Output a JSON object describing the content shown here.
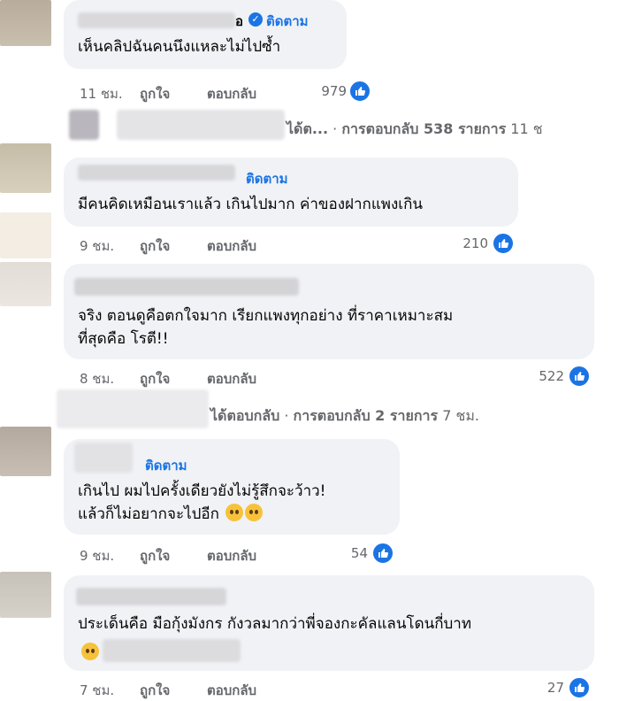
{
  "comments": [
    {
      "text": "เห็นคลิปฉันคนนึงแหละไม่ไปซ้ำ",
      "follow": "ติดตาม",
      "verified": true,
      "time": "11 ชม.",
      "like": "ถูกใจ",
      "reply": "ตอบกลับ",
      "reactions": "979"
    },
    {
      "text": "มีคนคิดเหมือนเราแล้ว เกินไปมาก ค่าของฝากแพงเกิน",
      "follow": "ติดตาม",
      "time": "9 ชม.",
      "like": "ถูกใจ",
      "reply": "ตอบกลับ",
      "reactions": "210"
    },
    {
      "text_line1": "จริง ตอนดูคือตกใจมาก เรียกแพงทุกอย่าง ที่ราคาเหมาะสม",
      "text_line2": "ที่สุดคือ โรตี!!",
      "time": "8 ชม.",
      "like": "ถูกใจ",
      "reply": "ตอบกลับ",
      "reactions": "522"
    },
    {
      "text_line1": "เกินไป ผมไปครั้งเดียวยังไม่รู้สึกจะว้าว!",
      "text_line2": "แล้วก็ไม่อยากจะไปอีก",
      "follow": "ติดตาม",
      "time": "9 ชม.",
      "like": "ถูกใจ",
      "reply": "ตอบกลับ",
      "reactions": "54"
    },
    {
      "text": "ประเด็นคือ มือกุ้งมังกร กังวลมากว่าพี่จองกะคัลแลนโดนกี่บาท",
      "time": "7 ชม.",
      "like": "ถูกใจ",
      "reply": "ตอบกลับ",
      "reactions": "27"
    }
  ],
  "replies_summary_1": {
    "prefix": "ได้ต...",
    "sep": "·",
    "count": "การตอบกลับ 538 รายการ",
    "time": "11 ช"
  },
  "replies_summary_2": {
    "prefix": "ได้ตอบกลับ",
    "sep": "·",
    "count": "การตอบกลับ 2 รายการ",
    "time": "7 ชม."
  },
  "name_fragment_1": "อ",
  "accent_color": "#1b74e4",
  "icons": [
    "like-icon",
    "verified-icon",
    "emoji-icon"
  ]
}
